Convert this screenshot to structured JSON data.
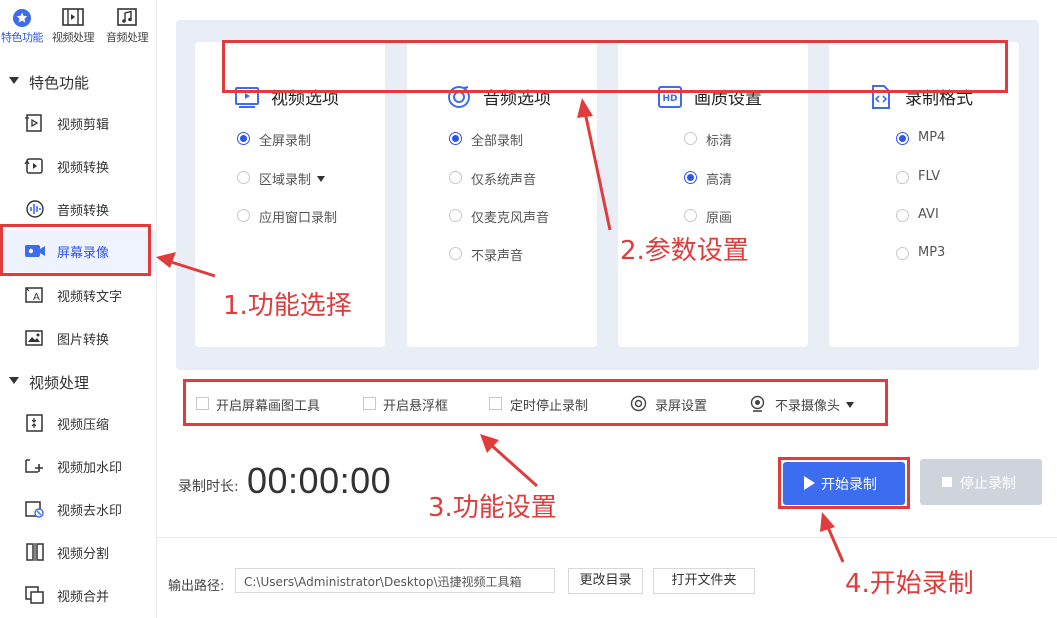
{
  "sidebar": {
    "top_tabs": [
      {
        "label": "特色功能",
        "icon": "star-icon"
      },
      {
        "label": "视频处理",
        "icon": "film-icon"
      },
      {
        "label": "音频处理",
        "icon": "music-file-icon"
      }
    ],
    "section_featured": "特色功能",
    "featured_items": [
      {
        "label": "视频剪辑",
        "icon": "video-edit-icon"
      },
      {
        "label": "视频转换",
        "icon": "video-convert-icon"
      },
      {
        "label": "音频转换",
        "icon": "audio-wave-icon"
      },
      {
        "label": "屏幕录像",
        "icon": "screen-record-icon"
      },
      {
        "label": "视频转文字",
        "icon": "video-to-text-icon"
      },
      {
        "label": "图片转换",
        "icon": "image-convert-icon"
      }
    ],
    "section_video": "视频处理",
    "video_items": [
      {
        "label": "视频压缩",
        "icon": "compress-icon"
      },
      {
        "label": "视频加水印",
        "icon": "add-watermark-icon"
      },
      {
        "label": "视频去水印",
        "icon": "remove-watermark-icon"
      },
      {
        "label": "视频分割",
        "icon": "split-icon"
      },
      {
        "label": "视频合并",
        "icon": "merge-icon"
      }
    ]
  },
  "cards": {
    "video": {
      "title": "视频选项",
      "options": [
        "全屏录制",
        "区域录制",
        "应用窗口录制"
      ],
      "selected": 0
    },
    "audio": {
      "title": "音频选项",
      "options": [
        "全部录制",
        "仅系统声音",
        "仅麦克风声音",
        "不录声音"
      ],
      "selected": 0
    },
    "quality": {
      "title": "画质设置",
      "options": [
        "标清",
        "高清",
        "原画"
      ],
      "selected": 1
    },
    "format": {
      "title": "录制格式",
      "options": [
        "MP4",
        "FLV",
        "AVI",
        "MP3"
      ],
      "selected": 0
    }
  },
  "tools": {
    "draw_tool": "开启屏幕画图工具",
    "float_box": "开启悬浮框",
    "timer_stop": "定时停止录制",
    "record_settings": "录屏设置",
    "camera": "不录摄像头"
  },
  "record": {
    "duration_label": "录制时长:",
    "duration_value": "00:00:00",
    "start_label": "开始录制",
    "stop_label": "停止录制"
  },
  "output": {
    "label": "输出路径:",
    "path": "C:\\Users\\Administrator\\Desktop\\迅捷视频工具箱",
    "change_dir": "更改目录",
    "open_folder": "打开文件夹"
  },
  "annotations": {
    "step1": "1.功能选择",
    "step2": "2.参数设置",
    "step3": "3.功能设置",
    "step4": "4.开始录制"
  },
  "colors": {
    "accent": "#2f54eb",
    "button": "#3c6df0",
    "annotation": "#e03c3c",
    "panel": "#e9edf5"
  }
}
